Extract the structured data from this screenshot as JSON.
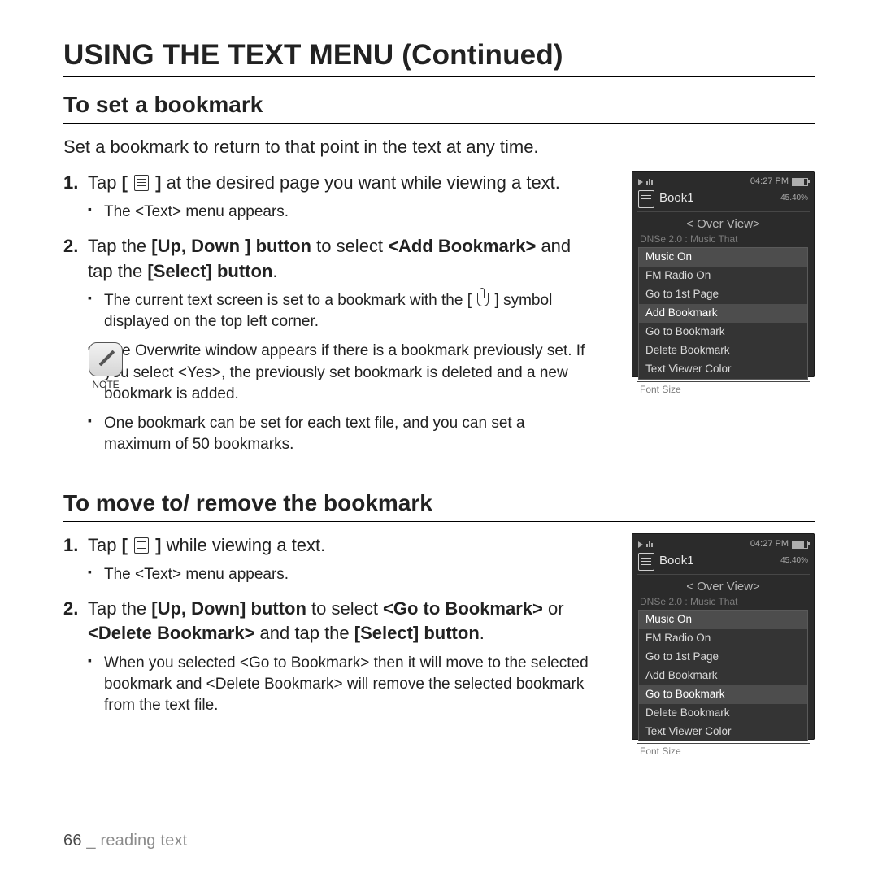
{
  "page": {
    "title": "USING THE TEXT MENU (Continued)",
    "footer_num": "66",
    "footer_sep": " _ ",
    "footer_label": "reading text"
  },
  "sec1": {
    "heading": "To set a bookmark",
    "intro": "Set a bookmark to return to that point in the text at any time.",
    "steps": {
      "s1a": "Tap ",
      "s1b": " at the desired page you want while viewing a text.",
      "s1_sub1": "The <Text> menu appears.",
      "s2a": "Tap the ",
      "s2b": "[Up, Down ] button",
      "s2c": " to select ",
      "s2d": "<Add Bookmark>",
      "s2e": " and tap the ",
      "s2f": "[Select] button",
      "s2g": ".",
      "s2_sub1a": "The current text screen is set to a bookmark with the ",
      "s2_sub1b": " symbol displayed on the top left corner.",
      "note_label": "NOTE",
      "s2_sub2": "The Overwrite window appears if there is a bookmark previously set. If you select <Yes>, the previously set bookmark is deleted and a new bookmark is added.",
      "s2_sub3": "One bookmark can be set for each text file, and you can set a maximum of 50 bookmarks."
    }
  },
  "sec2": {
    "heading": "To move to/ remove the bookmark",
    "steps": {
      "s1a": "Tap ",
      "s1b": " while viewing a text.",
      "s1_sub1": "The <Text> menu appears.",
      "s2a": "Tap the ",
      "s2b": "[Up, Down] button",
      "s2c": " to select ",
      "s2d": "<Go to Bookmark>",
      "s2e": " or ",
      "s2f": "<Delete Bookmark>",
      "s2g": " and tap the ",
      "s2h": "[Select] button",
      "s2i": ".",
      "s2_sub1": "When you selected <Go to Bookmark> then it will move to the selected bookmark and <Delete Bookmark> will remove the selected bookmark from the text file."
    }
  },
  "shot_common": {
    "time": "04:27 PM",
    "book": "Book1",
    "pct": "45.40%",
    "overview": "< Over View>",
    "ghost_top": "DNSe 2.0 : Music That",
    "ghost_bottom": "Font Size",
    "items": {
      "m1": "Music On",
      "m2": "FM Radio On",
      "m3": "Go to 1st Page",
      "m4": "Add Bookmark",
      "m5": "Go to Bookmark",
      "m6": "Delete Bookmark",
      "m7": "Text Viewer Color"
    }
  }
}
